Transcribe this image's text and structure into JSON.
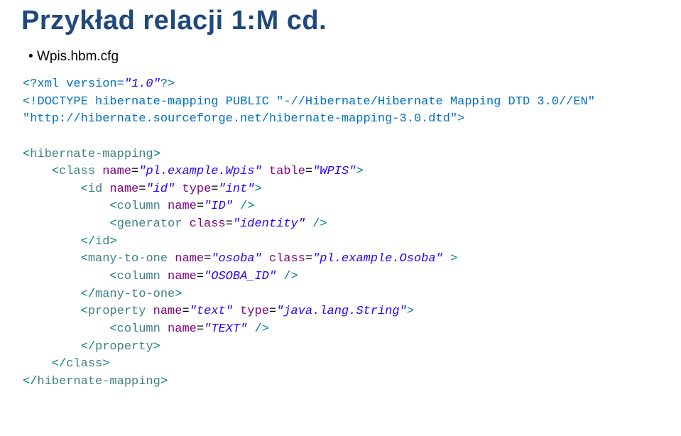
{
  "title": "Przykład relacji 1:M cd.",
  "bullet": "Wpis.hbm.cfg",
  "code": {
    "l1a": "<?xml version=",
    "l1b": "\"1.0\"",
    "l1c": "?>",
    "l2a": "<!DOCTYPE",
    "l2b": " hibernate-mapping ",
    "l2c": "PUBLIC",
    "l2d": " \"-//Hibernate/Hibernate Mapping DTD 3.0//EN\"",
    "l3": "\"http://hibernate.sourceforge.net/hibernate-mapping-3.0.dtd\"",
    "l3b": ">",
    "l5a": "<",
    "l5b": "hibernate-mapping",
    "l5c": ">",
    "l6a": "    <",
    "l6b": "class",
    "l6c": " name",
    "l6d": "=",
    "l6e": "\"pl.example.Wpis\"",
    "l6f": " table",
    "l6g": "=",
    "l6h": "\"WPIS\"",
    "l6i": ">",
    "l7a": "        <",
    "l7b": "id",
    "l7c": " name",
    "l7d": "=",
    "l7e": "\"id\"",
    "l7f": " type",
    "l7g": "=",
    "l7h": "\"int\"",
    "l7i": ">",
    "l8a": "            <",
    "l8b": "column",
    "l8c": " name",
    "l8d": "=",
    "l8e": "\"ID\"",
    "l8f": " />",
    "l9a": "            <",
    "l9b": "generator",
    "l9c": " class",
    "l9d": "=",
    "l9e": "\"identity\"",
    "l9f": " />",
    "l10a": "        </",
    "l10b": "id",
    "l10c": ">",
    "l11a": "        <",
    "l11b": "many-to-one",
    "l11c": " name",
    "l11d": "=",
    "l11e": "\"osoba\"",
    "l11f": " class",
    "l11g": "=",
    "l11h": "\"pl.example.Osoba\"",
    "l11i": " >",
    "l12a": "            <",
    "l12b": "column",
    "l12c": " name",
    "l12d": "=",
    "l12e": "\"OSOBA_ID\"",
    "l12f": " />",
    "l13a": "        </",
    "l13b": "many-to-one",
    "l13c": ">",
    "l14a": "        <",
    "l14b": "property",
    "l14c": " name",
    "l14d": "=",
    "l14e": "\"text\"",
    "l14f": " type",
    "l14g": "=",
    "l14h": "\"java.lang.String\"",
    "l14i": ">",
    "l15a": "            <",
    "l15b": "column",
    "l15c": " name",
    "l15d": "=",
    "l15e": "\"TEXT\"",
    "l15f": " />",
    "l16a": "        </",
    "l16b": "property",
    "l16c": ">",
    "l17a": "    </",
    "l17b": "class",
    "l17c": ">",
    "l18a": "</",
    "l18b": "hibernate-mapping",
    "l18c": ">"
  }
}
